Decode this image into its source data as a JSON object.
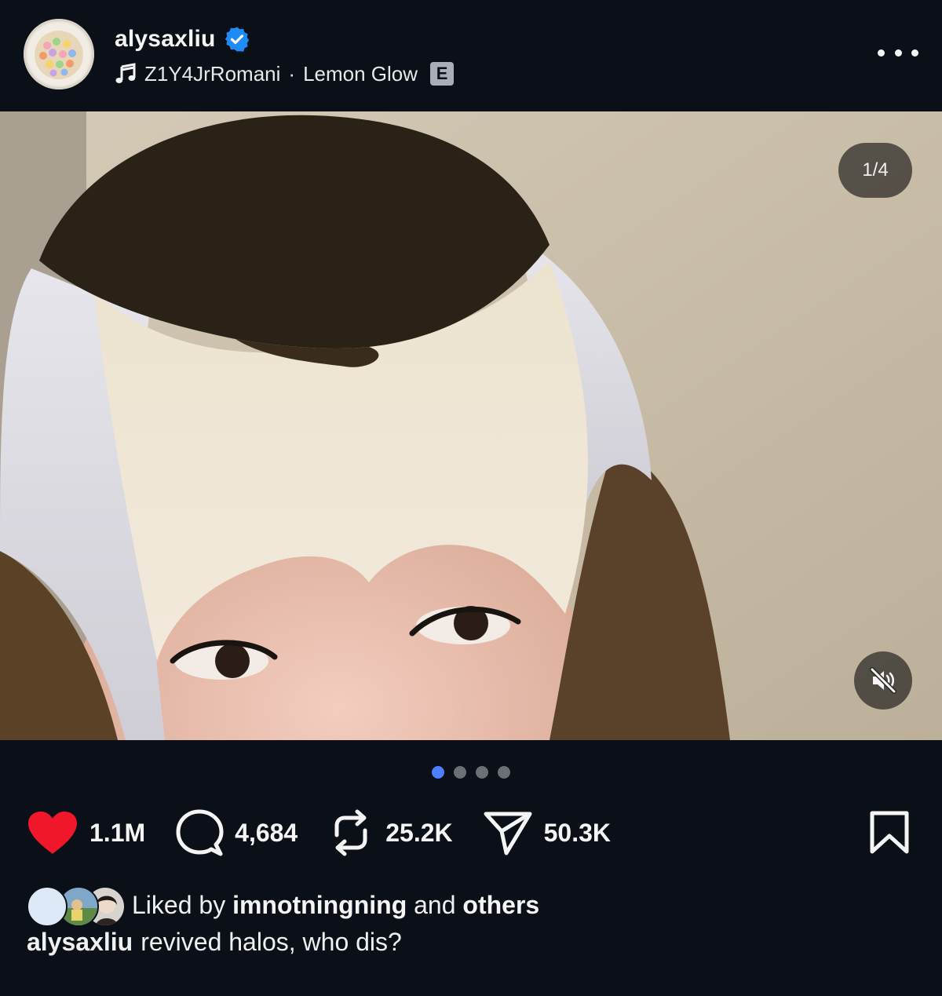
{
  "header": {
    "username": "alysaxliu",
    "verified_icon": "verified-badge-icon",
    "music": {
      "icon": "music-note-icon",
      "artist": "Z1Y4JrRomani",
      "separator": "·",
      "song": "Lemon Glow",
      "explicit_label": "E"
    },
    "more_icon": "more-horizontal-icon"
  },
  "media": {
    "page_indicator": "1/4",
    "mute_icon": "muted-speaker-icon",
    "current_page": 1,
    "total_pages": 4
  },
  "actions": {
    "like": {
      "icon": "heart-filled-icon",
      "count": "1.1M",
      "color": "#f0172a"
    },
    "comment": {
      "icon": "comment-bubble-icon",
      "count": "4,684"
    },
    "repost": {
      "icon": "repost-icon",
      "count": "25.2K"
    },
    "share": {
      "icon": "send-icon",
      "count": "50.3K"
    },
    "save": {
      "icon": "bookmark-icon"
    }
  },
  "likes": {
    "prefix": "Liked by",
    "user": "imnotningning",
    "connector": "and",
    "others": "others"
  },
  "caption": {
    "username": "alysaxliu",
    "text": "revived halos, who dis?"
  },
  "colors": {
    "background": "#0b1018",
    "accent_dot": "#4f7fff",
    "verified": "#1d8cf8"
  }
}
